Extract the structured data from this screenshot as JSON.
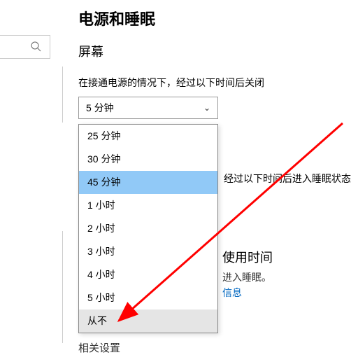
{
  "page_title": "电源和睡眠",
  "screen_section": "屏幕",
  "screen_off_label": "在接通电源的情况下，经过以下时间后关闭",
  "screen_off_value": "5 分钟",
  "dropdown_options": [
    {
      "label": "25 分钟",
      "state": ""
    },
    {
      "label": "30 分钟",
      "state": ""
    },
    {
      "label": "45 分钟",
      "state": "highlight"
    },
    {
      "label": "1 小时",
      "state": ""
    },
    {
      "label": "2 小时",
      "state": ""
    },
    {
      "label": "3 小时",
      "state": ""
    },
    {
      "label": "4 小时",
      "state": ""
    },
    {
      "label": "5 小时",
      "state": ""
    },
    {
      "label": "从不",
      "state": "hover"
    }
  ],
  "sleep_label_partial": "经过以下时间后进入睡眠状态",
  "usage_title": "使用时间",
  "usage_text": "进入睡眠。",
  "usage_link": "信息",
  "related_settings": "相关设置"
}
